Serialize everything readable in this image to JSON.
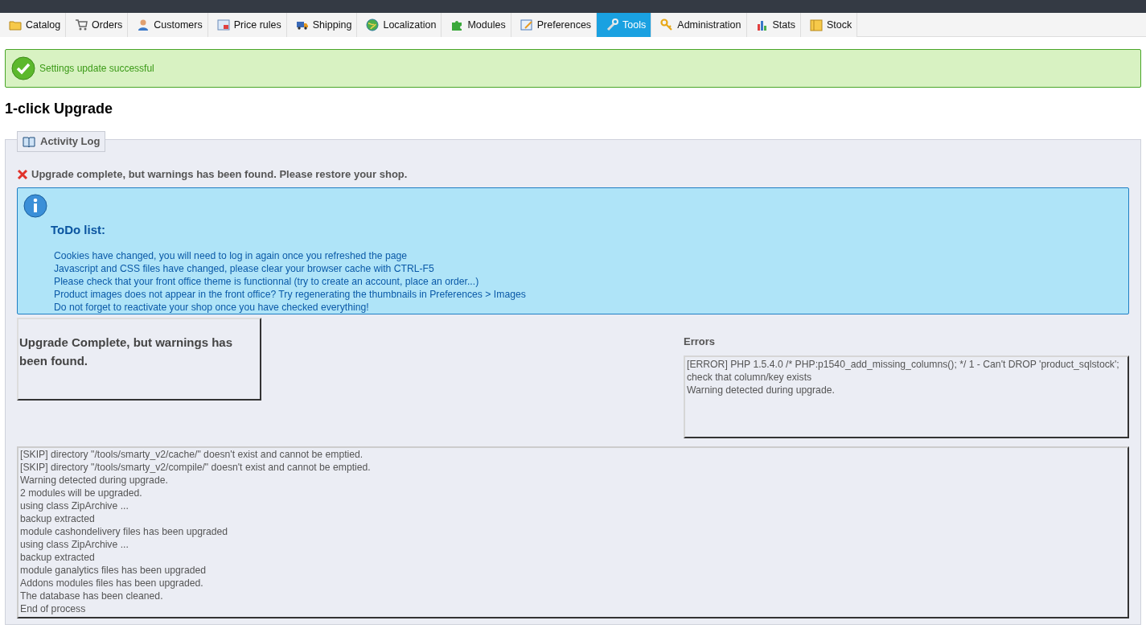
{
  "tabs": [
    {
      "label": "Catalog",
      "selected": false
    },
    {
      "label": "Orders",
      "selected": false
    },
    {
      "label": "Customers",
      "selected": false
    },
    {
      "label": "Price rules",
      "selected": false
    },
    {
      "label": "Shipping",
      "selected": false
    },
    {
      "label": "Localization",
      "selected": false
    },
    {
      "label": "Modules",
      "selected": false
    },
    {
      "label": "Preferences",
      "selected": false
    },
    {
      "label": "Tools",
      "selected": true
    },
    {
      "label": "Administration",
      "selected": false
    },
    {
      "label": "Stats",
      "selected": false
    },
    {
      "label": "Stock",
      "selected": false
    }
  ],
  "success_message": "Settings update successful",
  "page_title": "1-click Upgrade",
  "activity_log": {
    "legend": "Activity Log",
    "status_message": "Upgrade complete, but warnings has been found. Please restore your shop.",
    "todo": {
      "title": "ToDo list:",
      "items": [
        "Cookies have changed, you will need to log in again once you refreshed the page",
        "Javascript and CSS files have changed, please clear your browser cache with CTRL-F5",
        "Please check that your front office theme is functionnal (try to create an account, place an order...)",
        "Product images does not appear in the front office? Try regenerating the thumbnails in Preferences > Images",
        "Do not forget to reactivate your shop once you have checked everything!"
      ]
    },
    "result": "Upgrade Complete, but warnings has been found.",
    "errors": {
      "title": "Errors",
      "lines": [
        "[ERROR] PHP 1.5.4.0 /* PHP:p1540_add_missing_columns(); */ 1 - Can't DROP 'product_sqlstock'; check that column/key exists",
        "Warning detected during upgrade."
      ]
    },
    "log": [
      "[SKIP] directory \"/tools/smarty_v2/cache/\" doesn't exist and cannot be emptied.",
      "[SKIP] directory \"/tools/smarty_v2/compile/\" doesn't exist and cannot be emptied.",
      "Warning detected during upgrade.",
      "2 modules will be upgraded.",
      "using class ZipArchive ...",
      "backup extracted",
      "module cashondelivery files has been upgraded",
      "using class ZipArchive ...",
      "backup extracted",
      "module ganalytics files has been upgraded",
      "Addons modules files has been upgraded.",
      "The database has been cleaned.",
      "End of process"
    ]
  }
}
